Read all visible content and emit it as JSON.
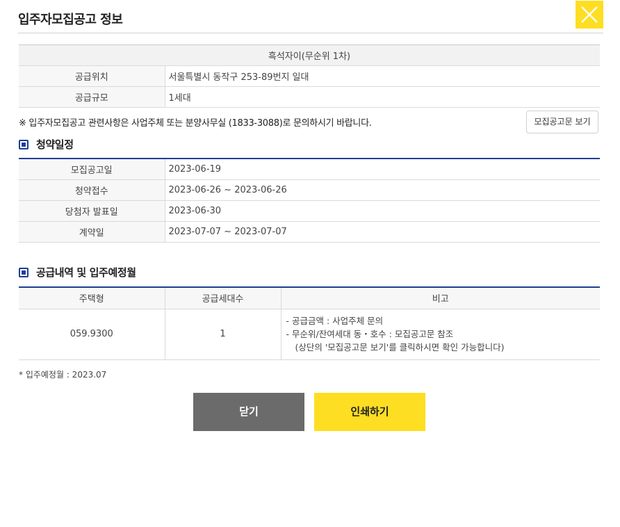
{
  "header": {
    "title": "입주자모집공고 정보"
  },
  "info": {
    "project_name": "흑석자이(무순위 1차)",
    "rows": [
      {
        "label": "공급위치",
        "value": "서울특별시 동작구 253-89번지 일대"
      },
      {
        "label": "공급규모",
        "value": "1세대"
      }
    ]
  },
  "notice": {
    "text": "※ 입주자모집공고 관련사항은 사업주체 또는 분양사무실 (1833-3088)로 문의하시기 바랍니다.",
    "button_label": "모집공고문 보기"
  },
  "schedule": {
    "title": "청약일정",
    "rows": [
      {
        "label": "모집공고일",
        "value": "2023-06-19"
      },
      {
        "label": "청약접수",
        "value": "2023-06-26 ~ 2023-06-26"
      },
      {
        "label": "당첨자 발표일",
        "value": "2023-06-30"
      },
      {
        "label": "계약일",
        "value": "2023-07-07 ~ 2023-07-07"
      }
    ]
  },
  "supply": {
    "title": "공급내역 및 입주예정월",
    "headers": [
      "주택형",
      "공급세대수",
      "비고"
    ],
    "rows": [
      {
        "type": "059.9300",
        "count": "1",
        "notes": [
          "-  공급금액 : 사업주체 문의",
          "-  무순위/잔여세대 동・호수 : 모집공고문 참조",
          "(상단의 '모집공고문 보기'를 클릭하시면 확인 가능합니다)"
        ]
      }
    ]
  },
  "move_in": "* 입주예정월 : 2023.07",
  "buttons": {
    "close": "닫기",
    "print": "인쇄하기"
  },
  "colors": {
    "accent_yellow": "#fede22",
    "section_blue": "#1c3e94",
    "close_gray": "#6b6b6b"
  }
}
